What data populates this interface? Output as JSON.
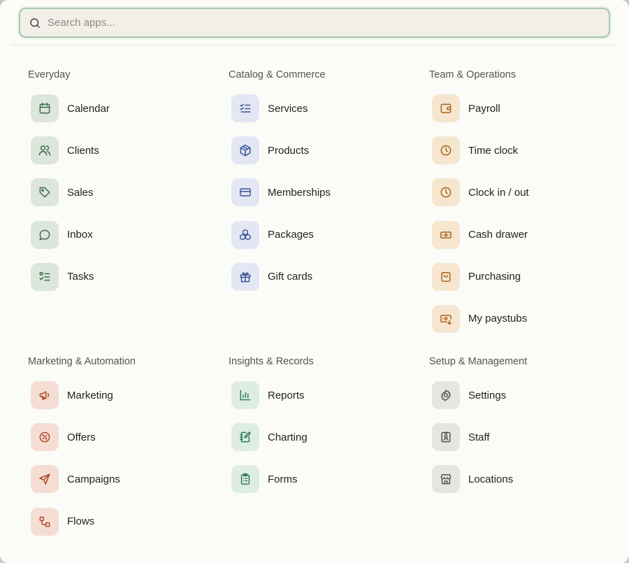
{
  "search": {
    "placeholder": "Search apps..."
  },
  "groups": [
    {
      "title": "Everyday",
      "items": [
        {
          "label": "Calendar"
        },
        {
          "label": "Clients"
        },
        {
          "label": "Sales"
        },
        {
          "label": "Inbox"
        },
        {
          "label": "Tasks"
        }
      ]
    },
    {
      "title": "Catalog & Commerce",
      "items": [
        {
          "label": "Services"
        },
        {
          "label": "Products"
        },
        {
          "label": "Memberships"
        },
        {
          "label": "Packages"
        },
        {
          "label": "Gift cards"
        }
      ]
    },
    {
      "title": "Team & Operations",
      "items": [
        {
          "label": "Payroll"
        },
        {
          "label": "Time clock"
        },
        {
          "label": "Clock in / out"
        },
        {
          "label": "Cash drawer"
        },
        {
          "label": "Purchasing"
        },
        {
          "label": "My paystubs"
        }
      ]
    },
    {
      "title": "Marketing & Automation",
      "items": [
        {
          "label": "Marketing"
        },
        {
          "label": "Offers"
        },
        {
          "label": "Campaigns"
        },
        {
          "label": "Flows"
        }
      ]
    },
    {
      "title": "Insights & Records",
      "items": [
        {
          "label": "Reports"
        },
        {
          "label": "Charting"
        },
        {
          "label": "Forms"
        }
      ]
    },
    {
      "title": "Setup & Management",
      "items": [
        {
          "label": "Settings"
        },
        {
          "label": "Staff"
        },
        {
          "label": "Locations"
        }
      ]
    }
  ],
  "icons": {
    "calendar": "calendar-icon",
    "clients": "users-icon",
    "sales": "tag-icon",
    "inbox": "message-bubble-icon",
    "tasks": "checklist-icon",
    "services": "checklist-icon",
    "products": "box-icon",
    "memberships": "card-icon",
    "packages": "stacked-boxes-icon",
    "gift_cards": "gift-icon",
    "payroll": "wallet-icon",
    "time_clock": "clock-icon",
    "clock_in_out": "clock-icon",
    "cash_drawer": "cash-icon",
    "purchasing": "shopping-bag-icon",
    "my_paystubs": "paystub-icon",
    "marketing": "megaphone-icon",
    "offers": "discount-badge-icon",
    "campaigns": "send-icon",
    "flows": "flow-icon",
    "reports": "bar-chart-icon",
    "charting": "notebook-pen-icon",
    "forms": "clipboard-icon",
    "settings": "gear-icon",
    "staff": "id-badge-icon",
    "locations": "store-icon"
  },
  "colors": {
    "accent_border": "#a9c8ad",
    "everyday": "#3f6b4b",
    "catalog": "#3a5597",
    "team": "#a8641c",
    "marketing": "#b04a2a",
    "insights": "#2f7a54",
    "setup": "#55554f"
  }
}
